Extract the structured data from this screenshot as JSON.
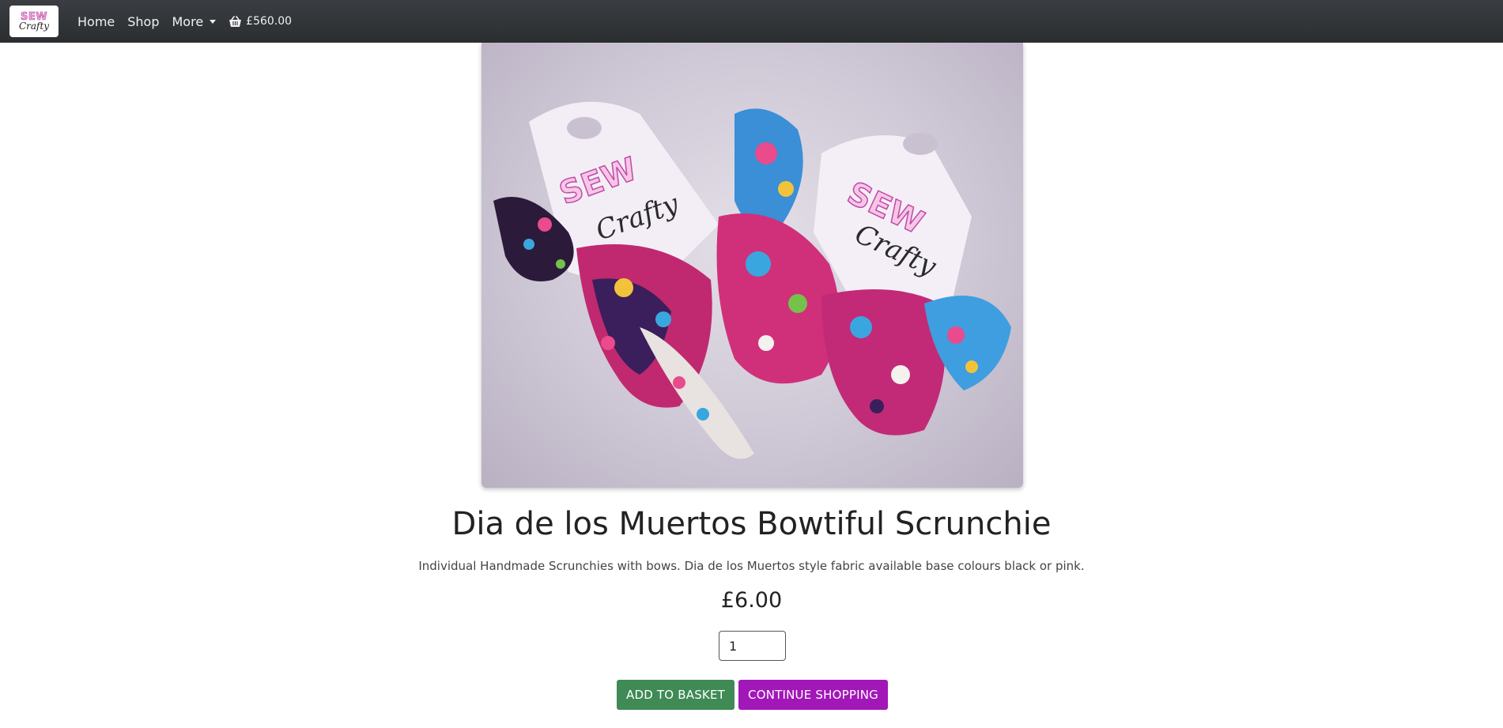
{
  "brand": {
    "logo_top": "SEW",
    "logo_bottom": "Crafty"
  },
  "nav": {
    "items": [
      {
        "label": "Home"
      },
      {
        "label": "Shop"
      },
      {
        "label": "More"
      }
    ],
    "basket_total": "£560.00",
    "basket_icon": "basket-icon"
  },
  "product": {
    "image": {
      "alt": "Sew Crafty scrunchies on branded cards",
      "card_text_top": "SEW",
      "card_text_bottom": "Crafty"
    },
    "title": "Dia de los Muertos Bowtiful Scrunchie",
    "description": "Individual Handmade Scrunchies with bows. Dia de los Muertos style fabric available base colours black or pink.",
    "price": "£6.00",
    "quantity": "1"
  },
  "actions": {
    "add_to_basket": "ADD TO BASKET",
    "continue_shopping": "CONTINUE SHOPPING"
  },
  "colors": {
    "navbar": "#2f3236",
    "add_button": "#3f8a55",
    "continue_button": "#a217b8"
  }
}
